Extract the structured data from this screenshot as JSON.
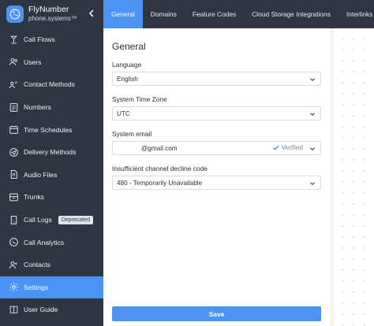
{
  "brand": {
    "name": "FlyNumber",
    "subtitle": "phone.systems™"
  },
  "sidebar": {
    "items": [
      {
        "label": "Call Flows",
        "icon": "call-flows-icon"
      },
      {
        "label": "Users",
        "icon": "users-icon"
      },
      {
        "label": "Contact Methods",
        "icon": "contact-methods-icon"
      },
      {
        "label": "Numbers",
        "icon": "numbers-icon"
      },
      {
        "label": "Time Schedules",
        "icon": "calendar-icon"
      },
      {
        "label": "Delivery Methods",
        "icon": "delivery-methods-icon"
      },
      {
        "label": "Audio Files",
        "icon": "audio-file-icon"
      },
      {
        "label": "Trunks",
        "icon": "trunks-icon"
      },
      {
        "label": "Call Logs",
        "icon": "call-logs-icon",
        "badge": "Deprecated"
      },
      {
        "label": "Call Analytics",
        "icon": "analytics-icon"
      },
      {
        "label": "Contacts",
        "icon": "contacts-icon"
      },
      {
        "label": "Settings",
        "icon": "gear-icon",
        "active": true
      },
      {
        "label": "User Guide",
        "icon": "book-icon"
      }
    ]
  },
  "tabs": [
    {
      "label": "General",
      "active": true
    },
    {
      "label": "Domains"
    },
    {
      "label": "Feature Codes"
    },
    {
      "label": "Cloud Storage Integrations"
    },
    {
      "label": "Interlinks"
    }
  ],
  "main": {
    "title": "General",
    "fields": {
      "language": {
        "label": "Language",
        "value": "English"
      },
      "timezone": {
        "label": "System Time Zone",
        "value": "UTC"
      },
      "email": {
        "label": "System email",
        "value": "@gmail.com",
        "status": "Verified"
      },
      "decline": {
        "label": "Insufficient channel decline code",
        "value": "480 - Temporarily Unavailable"
      }
    },
    "save_label": "Save"
  },
  "colors": {
    "sidebar_bg": "#2f3641",
    "accent": "#4c93f4"
  }
}
